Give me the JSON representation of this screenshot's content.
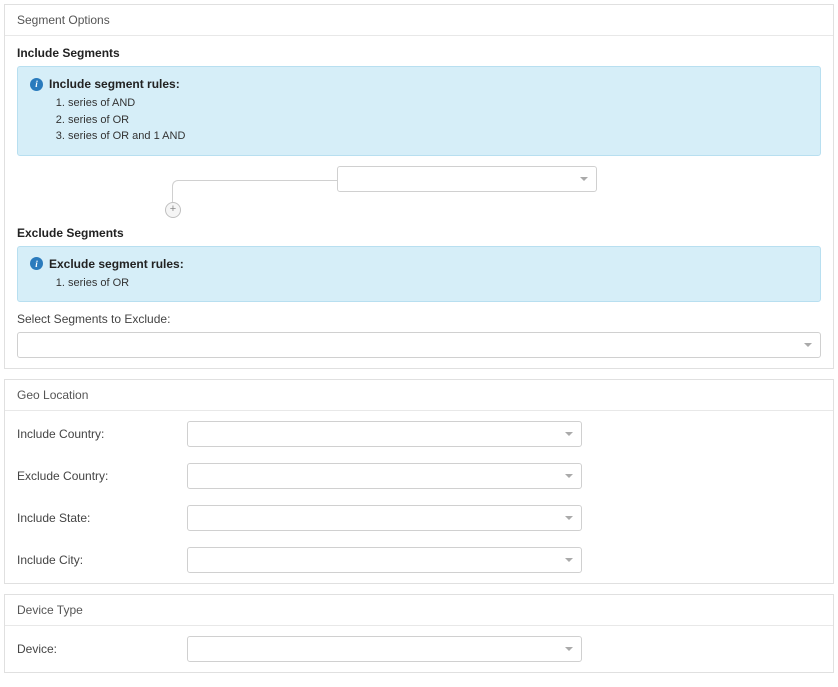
{
  "segmentOptions": {
    "header": "Segment Options",
    "includeSegments": {
      "title": "Include Segments",
      "infoTitle": "Include segment rules:",
      "rules": [
        "series of AND",
        "series of OR",
        "series of OR and 1 AND"
      ]
    },
    "excludeSegments": {
      "title": "Exclude Segments",
      "infoTitle": "Exclude segment rules:",
      "rules": [
        "series of OR"
      ],
      "selectLabel": "Select Segments to Exclude:"
    }
  },
  "geoLocation": {
    "header": "Geo Location",
    "fields": {
      "includeCountry": "Include Country:",
      "excludeCountry": "Exclude Country:",
      "includeState": "Include State:",
      "includeCity": "Include City:"
    }
  },
  "deviceType": {
    "header": "Device Type",
    "fields": {
      "device": "Device:"
    }
  }
}
